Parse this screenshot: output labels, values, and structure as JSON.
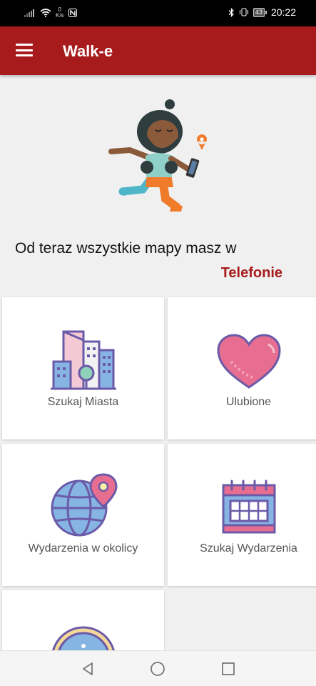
{
  "status_bar": {
    "speed_value": "0",
    "speed_unit": "K/s",
    "battery": "43",
    "time": "20:22"
  },
  "app_bar": {
    "title": "Walk-e"
  },
  "hero": {
    "text": "Od teraz wszystkie mapy masz w",
    "highlight": "Telefonie"
  },
  "menu": [
    {
      "label": "Szukaj Miasta",
      "icon": "city-buildings-icon"
    },
    {
      "label": "Ulubione",
      "icon": "heart-icon"
    },
    {
      "label": "Wydarzenia w okolicy",
      "icon": "globe-location-icon"
    },
    {
      "label": "Szukaj Wydarzenia",
      "icon": "calendar-icon"
    },
    {
      "label": "",
      "icon": "info-icon"
    }
  ],
  "colors": {
    "primary": "#a71b1d",
    "icon_outline": "#6b5aa8",
    "icon_fill_blue": "#86b4e3",
    "icon_fill_pink": "#e76e90"
  }
}
